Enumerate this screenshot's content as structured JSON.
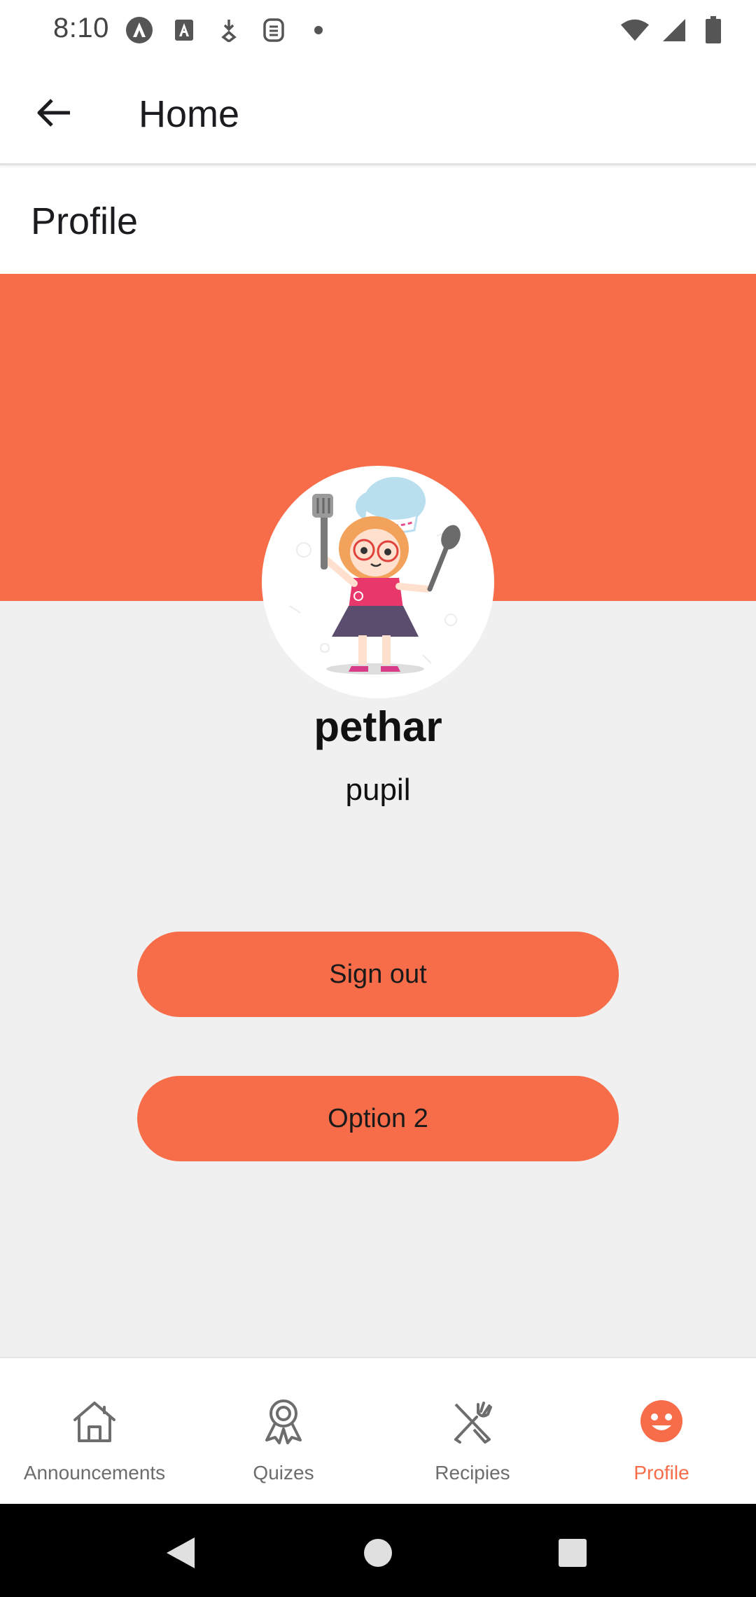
{
  "status_bar": {
    "time": "8:10",
    "left_icons": [
      "android-auto-icon",
      "text-a-icon",
      "download-icon",
      "sim-icon",
      "dot-icon"
    ],
    "right_icons": [
      "wifi-icon",
      "signal-icon",
      "battery-icon"
    ]
  },
  "app_bar": {
    "title": "Home",
    "back_icon": "arrow-left-icon"
  },
  "section": {
    "title": "Profile"
  },
  "profile": {
    "username": "pethar",
    "role": "pupil",
    "avatar": "chef-girl-avatar"
  },
  "buttons": {
    "sign_out": "Sign out",
    "option2": "Option 2"
  },
  "bottom_nav": {
    "items": [
      {
        "label": "Announcements",
        "icon": "home-icon",
        "active": false
      },
      {
        "label": "Quizes",
        "icon": "award-ribbon-icon",
        "active": false
      },
      {
        "label": "Recipies",
        "icon": "utensils-icon",
        "active": false
      },
      {
        "label": "Profile",
        "icon": "smile-face-icon",
        "active": true
      }
    ]
  },
  "colors": {
    "accent": "#f76d4a",
    "background": "#f1f0f0",
    "nav_inactive": "#6d6d6d"
  },
  "system_nav": {
    "back": "back-triangle-icon",
    "home": "home-circle-icon",
    "recents": "recents-square-icon"
  }
}
